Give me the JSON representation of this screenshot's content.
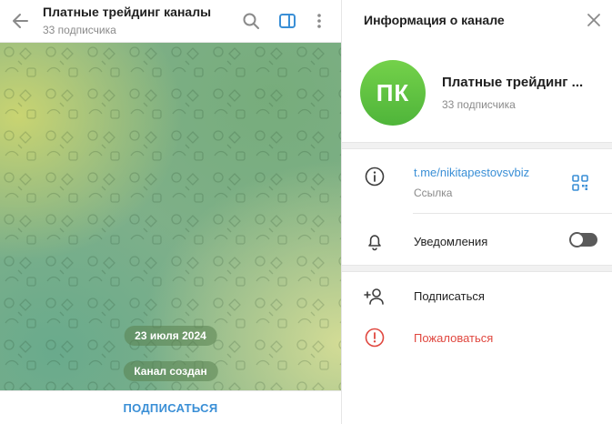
{
  "chat": {
    "title": "Платные трейдинг каналы",
    "subtitle": "33 подписчика",
    "date_pill": "23 июля 2024",
    "service_message": "Канал создан",
    "subscribe_button": "ПОДПИСАТЬСЯ"
  },
  "info_panel": {
    "header": "Информация о канале",
    "avatar_initials": "ПК",
    "channel_name": "Платные трейдинг ...",
    "subscribers": "33 подписчика",
    "link": "t.me/nikitapestovsvbiz",
    "link_label": "Ссылка",
    "notifications_label": "Уведомления",
    "notifications_enabled": false,
    "subscribe_label": "Подписаться",
    "report_label": "Пожаловаться"
  },
  "icons": {
    "back": "arrow-left-icon",
    "search": "search-icon",
    "side_panel": "side-panel-icon",
    "more": "more-vertical-icon",
    "close": "close-icon",
    "info": "info-icon",
    "qr": "qr-code-icon",
    "bell": "bell-icon",
    "add_user": "add-user-icon",
    "report": "alert-icon"
  },
  "colors": {
    "accent": "#3a8fd6",
    "avatar": "#5fc140",
    "danger": "#e0473f"
  }
}
